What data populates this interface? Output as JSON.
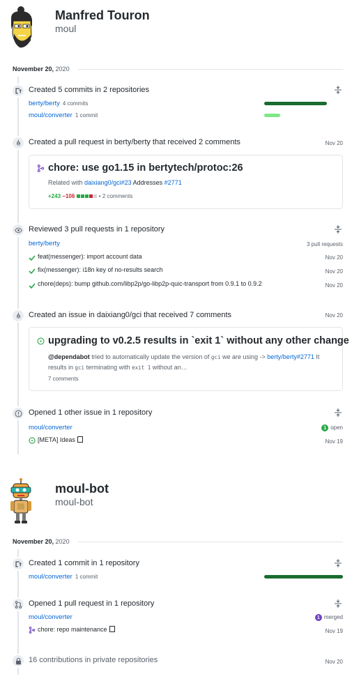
{
  "users": [
    {
      "name": "Manfred Touron",
      "login": "moul",
      "date": {
        "month_day": "November 20,",
        "year": "2020"
      },
      "commits": {
        "title": "Created 5 commits in 2 repositories",
        "repos": [
          {
            "name": "berty/berty",
            "count": "4 commits",
            "fraction": 0.8
          },
          {
            "name": "moul/converter",
            "count": "1 commit",
            "fraction": 0.2
          }
        ]
      },
      "pr_event": {
        "title": "Created a pull request in berty/berty that received 2 comments",
        "date": "Nov 20",
        "card": {
          "title": "chore: use go1.15 in bertytech/protoc:26",
          "related_prefix": "Related with",
          "related_link": "daixiang0/gci#23",
          "addresses_prefix": "Addresses",
          "addresses_link": "#2771",
          "additions": "+243",
          "deletions": "−106",
          "comments": "2 comments"
        }
      },
      "reviews": {
        "title": "Reviewed 3 pull requests in 1 repository",
        "repo": "berty/berty",
        "repo_count": "3 pull requests",
        "items": [
          {
            "text": "feat(messenger): import account data",
            "date": "Nov 20"
          },
          {
            "text": "fix(messenger): i18n key of no-results search",
            "date": "Nov 20"
          },
          {
            "text": "chore(deps): bump github.com/libp2p/go-libp2p-quic-transport from 0.9.1 to 0.9.2",
            "date": "Nov 20"
          }
        ]
      },
      "issue_event": {
        "title": "Created an issue in daixiang0/gci that received 7 comments",
        "date": "Nov 20",
        "card": {
          "title": "upgrading to v0.2.5 results in `exit 1` without any other change",
          "author": "@dependabot",
          "body_1": "tried to automatically update the version of",
          "code_1": "gci",
          "body_2": "we are using ->",
          "link": "berty/berty#2771",
          "body_3": "It results in",
          "code_2": "gci",
          "body_4": "terminating with",
          "code_3": "exit 1",
          "body_5": "without an…",
          "comments": "7 comments"
        }
      },
      "other_issue": {
        "title": "Opened 1 other issue in 1 repository",
        "repo": "moul/converter",
        "open_count": "1",
        "open_label": "open",
        "item": "[META] Ideas",
        "item_date": "Nov 19"
      }
    },
    {
      "name": "moul-bot",
      "login": "moul-bot",
      "date": {
        "month_day": "November 20,",
        "year": "2020"
      },
      "commits": {
        "title": "Created 1 commit in 1 repository",
        "repo": "moul/converter",
        "count": "1 commit",
        "fraction": 1.0
      },
      "pr_opened": {
        "title": "Opened 1 pull request in 1 repository",
        "repo": "moul/converter",
        "merged_count": "1",
        "merged_label": "merged",
        "item": "chore: repo maintenance",
        "item_date": "Nov 19"
      },
      "private": {
        "title": "16 contributions in private repositories",
        "date": "Nov 20"
      }
    }
  ],
  "colors": {
    "link": "#0366d6",
    "bar_dark": "#196c2e",
    "bar_light": "#7ee787",
    "open_green": "#28a745",
    "merged_purple": "#6f42c1",
    "addition": "#28a745",
    "deletion": "#cb2431"
  },
  "icons": [
    "repo-push-icon",
    "flame-icon",
    "eye-icon",
    "info-icon",
    "pull-request-icon",
    "lock-icon",
    "fold-icon",
    "check-icon",
    "issue-opened-icon",
    "git-pull-request-icon"
  ]
}
